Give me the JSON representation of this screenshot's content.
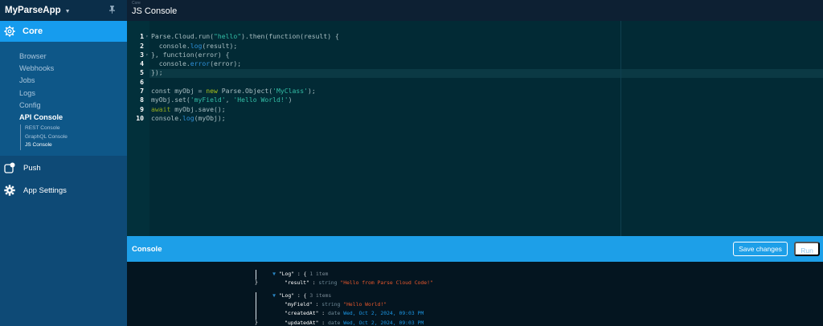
{
  "app": {
    "name": "MyParseApp"
  },
  "sidebar": {
    "core_label": "Core",
    "core_items": [
      "Browser",
      "Webhooks",
      "Jobs",
      "Logs",
      "Config"
    ],
    "api_console_label": "API Console",
    "api_items": [
      "REST Console",
      "GraphQL Console",
      "JS Console"
    ],
    "push_label": "Push",
    "settings_label": "App Settings"
  },
  "topbar": {
    "crumb": "Core",
    "title": "JS Console"
  },
  "editor": {
    "lines": [
      "1",
      "2",
      "3",
      "4",
      "5",
      "6",
      "7",
      "8",
      "9",
      "10"
    ]
  },
  "console": {
    "title": "Console",
    "save_label": "Save changes",
    "run_label": "Run"
  },
  "output": {
    "log1_key": "\"Log\"",
    "log1_count": "1 item",
    "log1_fields": [
      {
        "key": "\"result\"",
        "type": "string",
        "value": "\"Hello from Parse Cloud Code!\""
      }
    ],
    "log2_key": "\"Log\"",
    "log2_count": "3 items",
    "log2_fields": [
      {
        "key": "\"myField\"",
        "type": "string",
        "value": "\"Hello World!\""
      },
      {
        "key": "\"createdAt\"",
        "type": "date",
        "value": "Wed, Oct 2, 2024, 09:03 PM"
      },
      {
        "key": "\"updatedAt\"",
        "type": "date",
        "value": "Wed, Oct 2, 2024, 09:03 PM"
      }
    ]
  }
}
